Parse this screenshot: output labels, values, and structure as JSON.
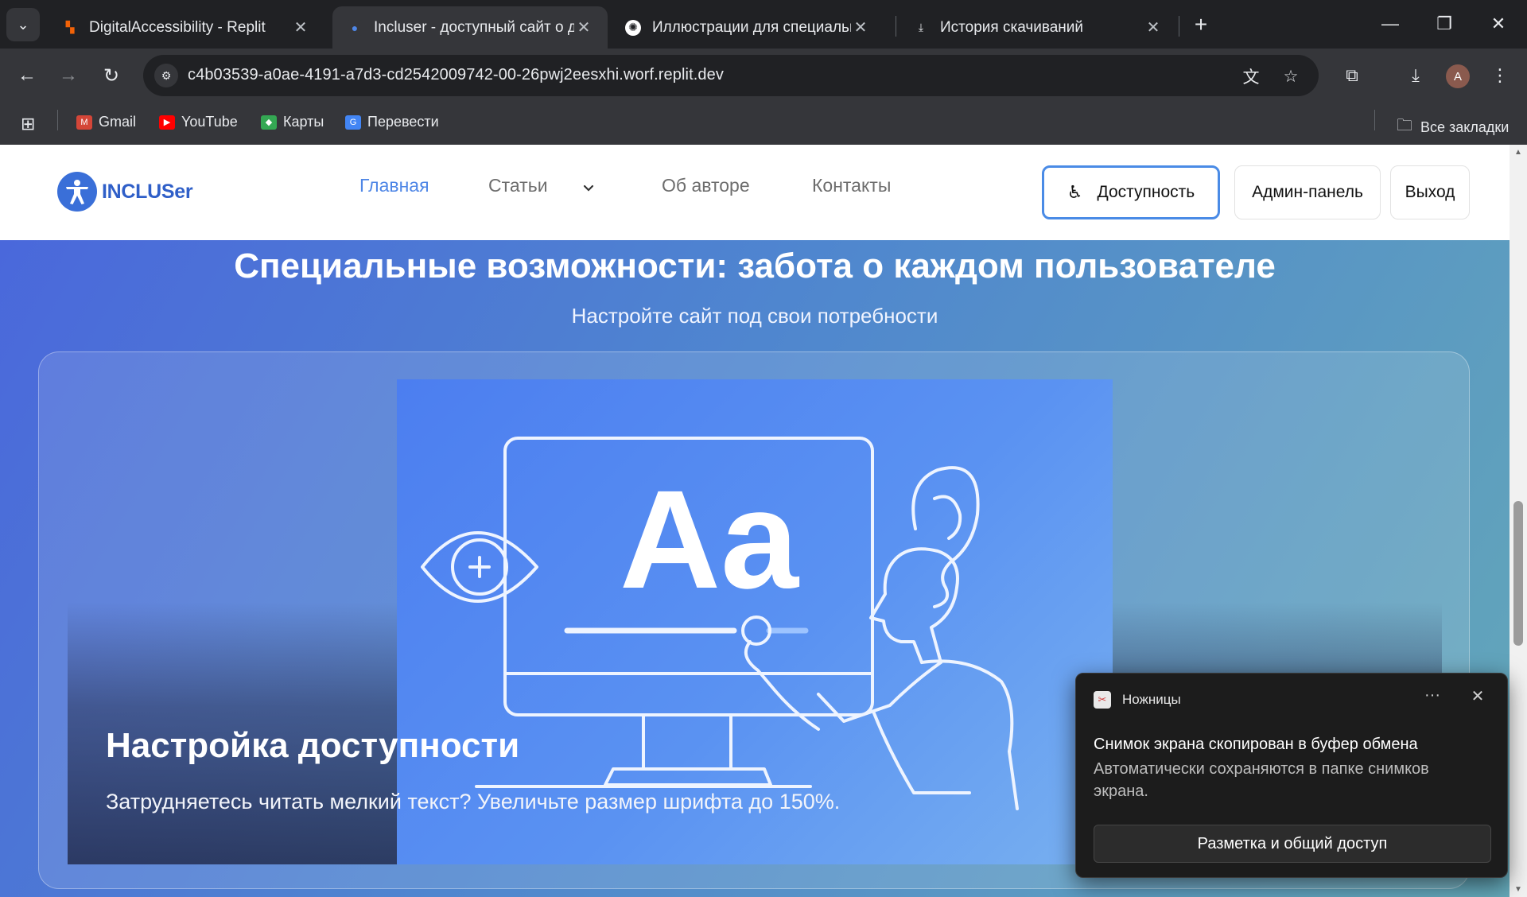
{
  "browser": {
    "tabs": [
      {
        "title": "DigitalAccessibility - Replit",
        "active": false
      },
      {
        "title": "Incluser - доступный сайт о до",
        "active": true
      },
      {
        "title": "Иллюстрации для специальны",
        "active": false
      },
      {
        "title": "История скачиваний",
        "active": false
      }
    ],
    "url": "c4b03539-a0ae-4191-a7d3-cd2542009742-00-26pwj2eesxhi.worf.replit.dev",
    "profile_initial": "A",
    "bookmarks": [
      {
        "label": "Gmail",
        "icon": "gmail-icon",
        "color": "#d44638"
      },
      {
        "label": "YouTube",
        "icon": "youtube-icon",
        "color": "#ff0000"
      },
      {
        "label": "Карты",
        "icon": "maps-icon",
        "color": "#34a853"
      },
      {
        "label": "Перевести",
        "icon": "translate-icon",
        "color": "#4285f4"
      }
    ],
    "all_bookmarks_label": "Все закладки"
  },
  "site": {
    "logo_text": "INCLUSer",
    "nav": {
      "home": "Главная",
      "articles": "Статьи",
      "about": "Об авторе",
      "contacts": "Контакты"
    },
    "buttons": {
      "accessibility": "Доступность",
      "admin": "Админ-панель",
      "logout": "Выход"
    },
    "accent_color": "#4e86e6"
  },
  "hero": {
    "title": "Специальные возможности: забота о каждом пользователе",
    "subtitle": "Настройте сайт под свои потребности"
  },
  "card": {
    "illustration_text": "Aa",
    "heading": "Настройка доступности",
    "text": "Затрудняетесь читать мелкий текст? Увеличьте размер шрифта до 150%."
  },
  "toast": {
    "app_name": "Ножницы",
    "title": "Снимок экрана скопирован в буфер обмена",
    "body": "Автоматически сохраняются в папке снимков экрана.",
    "button": "Разметка и общий доступ"
  }
}
